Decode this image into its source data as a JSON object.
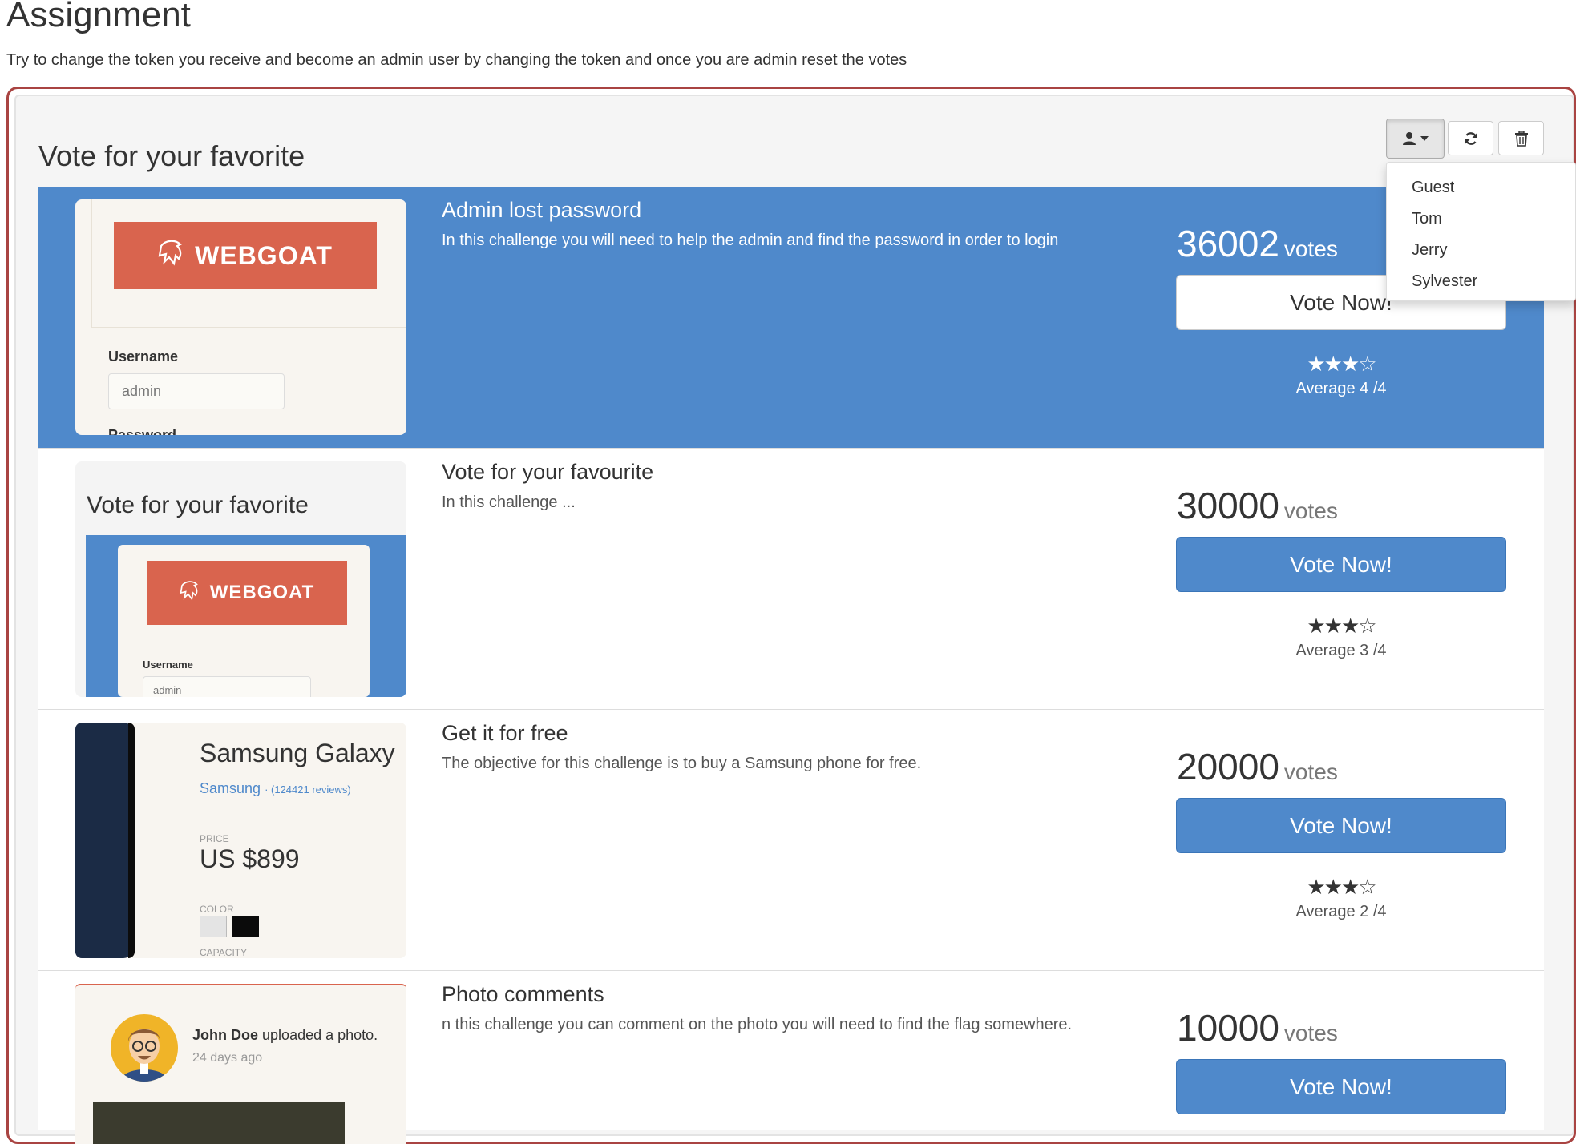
{
  "page": {
    "title": "Assignment",
    "instructions": "Try to change the token you receive and become an admin user by changing the token and once you are admin reset the votes"
  },
  "section": {
    "title": "Vote for your favorite"
  },
  "toolbar": {
    "user_icon": "user-icon",
    "refresh_icon": "refresh-icon",
    "delete_icon": "trash-icon"
  },
  "dropdown": {
    "items": [
      "Guest",
      "Tom",
      "Jerry",
      "Sylvester"
    ]
  },
  "rows": [
    {
      "title": "Admin lost password",
      "description": "In this challenge you will need to help the admin and find the password in order to login",
      "votes": "36002",
      "votes_word": "votes",
      "vote_button": "Vote Now!",
      "stars": "★★★☆",
      "average": "Average 4 /4",
      "thumb": {
        "brand": "WEBGOAT",
        "username_label": "Username",
        "username_value": "admin",
        "password_label": "Password"
      }
    },
    {
      "title": "Vote for your favourite",
      "description": "In this challenge ...",
      "votes": "30000",
      "votes_word": "votes",
      "vote_button": "Vote Now!",
      "stars": "★★★☆",
      "average": "Average 3 /4",
      "thumb": {
        "heading": "Vote for your favorite",
        "brand": "WEBGOAT",
        "username_label": "Username",
        "username_value": "admin"
      }
    },
    {
      "title": "Get it for free",
      "description": "The objective for this challenge is to buy a Samsung phone for free.",
      "votes": "20000",
      "votes_word": "votes",
      "vote_button": "Vote Now!",
      "stars": "★★★☆",
      "average": "Average 2 /4",
      "thumb": {
        "product": "Samsung Galaxy",
        "maker": "Samsung",
        "reviews": "(124421 reviews)",
        "price_label": "PRICE",
        "price": "US $899",
        "color_label": "COLOR",
        "capacity_label": "CAPACITY"
      }
    },
    {
      "title": "Photo comments",
      "description": "n this challenge you can comment on the photo you will need to find the flag somewhere.",
      "votes": "10000",
      "votes_word": "votes",
      "vote_button": "Vote Now!",
      "thumb": {
        "user": "John Doe",
        "action": "uploaded a photo.",
        "time": "24 days ago"
      }
    }
  ],
  "colors": {
    "primary": "#4f89cb",
    "frame_border": "#a94442",
    "brand": "#d9644e"
  }
}
